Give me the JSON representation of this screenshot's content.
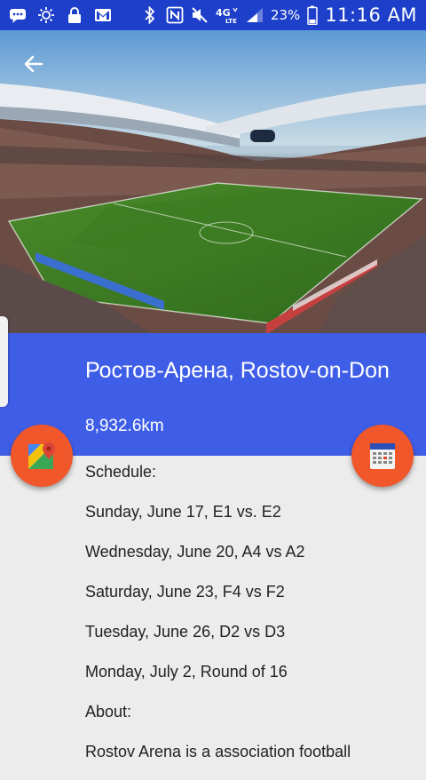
{
  "status_bar": {
    "icons_left": [
      "messages-icon",
      "brightness-icon",
      "lock-icon",
      "gmail-icon"
    ],
    "icons_right": [
      "bluetooth-icon",
      "nfc-icon",
      "mute-icon",
      "lte-icon",
      "signal-icon"
    ],
    "network": "4G LTE",
    "battery": "23%",
    "time": "11:16 AM"
  },
  "header": {
    "back_icon": "arrow-left-icon",
    "title": "Ростов-Арена, Rostov-on-Don",
    "distance": "8,932.6km"
  },
  "fabs": {
    "maps_icon": "google-maps-icon",
    "calendar_icon": "calendar-icon"
  },
  "schedule": {
    "label": "Schedule:",
    "items": [
      "Sunday, June 17, E1 vs. E2",
      "Wednesday, June 20, A4 vs A2",
      "Saturday, June 23, F4 vs F2",
      "Tuesday, June 26, D2 vs D3",
      "Monday, July 2, Round of 16"
    ]
  },
  "about": {
    "label": "About:",
    "text": "Rostov Arena is a association football"
  },
  "colors": {
    "status_bar": "#1d3fc9",
    "header_band": "#3f5ee8",
    "fab": "#f0572a",
    "background": "#ececec"
  }
}
